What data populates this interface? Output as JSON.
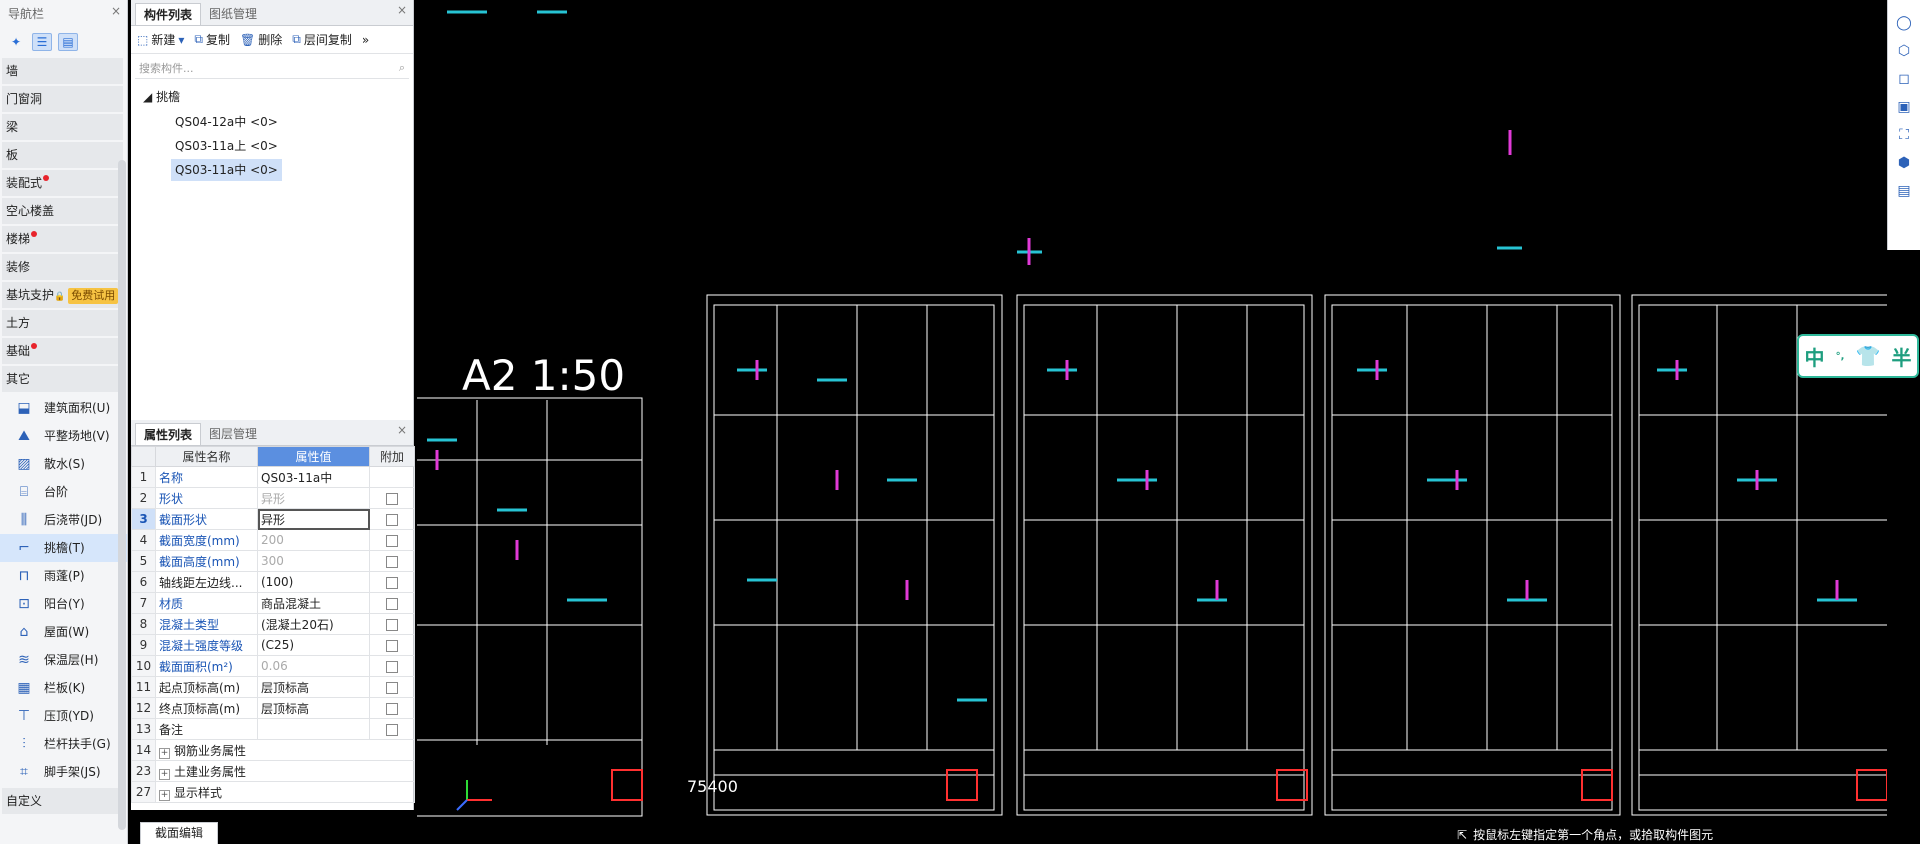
{
  "nav": {
    "title": "导航栏",
    "close": "×",
    "categories": [
      {
        "label": "墙"
      },
      {
        "label": "门窗洞"
      },
      {
        "label": "梁"
      },
      {
        "label": "板"
      },
      {
        "label": "装配式"
      },
      {
        "label": "空心楼盖"
      },
      {
        "label": "楼梯"
      },
      {
        "label": "装修"
      },
      {
        "label": "基坑支护",
        "badge": "免费试用"
      },
      {
        "label": "土方"
      },
      {
        "label": "基础"
      },
      {
        "label": "其它"
      }
    ],
    "subitems": [
      {
        "label": "建筑面积(U)",
        "icon": "area-icon"
      },
      {
        "label": "平整场地(V)",
        "icon": "level-site-icon"
      },
      {
        "label": "散水(S)",
        "icon": "apron-icon"
      },
      {
        "label": "台阶",
        "icon": "step-icon"
      },
      {
        "label": "后浇带(JD)",
        "icon": "post-pour-icon"
      },
      {
        "label": "挑檐(T)",
        "icon": "eave-icon"
      },
      {
        "label": "雨蓬(P)",
        "icon": "canopy-icon"
      },
      {
        "label": "阳台(Y)",
        "icon": "balcony-icon"
      },
      {
        "label": "屋面(W)",
        "icon": "roof-icon"
      },
      {
        "label": "保温层(H)",
        "icon": "insulation-icon"
      },
      {
        "label": "栏板(K)",
        "icon": "parapet-icon"
      },
      {
        "label": "压顶(YD)",
        "icon": "coping-icon"
      },
      {
        "label": "栏杆扶手(G)",
        "icon": "railing-icon"
      },
      {
        "label": "脚手架(JS)",
        "icon": "scaffold-icon"
      }
    ],
    "custom": "自定义"
  },
  "comp": {
    "tabs": [
      "构件列表",
      "图纸管理"
    ],
    "toolbar": {
      "new": "新建",
      "copy": "复制",
      "delete": "删除",
      "floor_copy": "层间复制"
    },
    "search_placeholder": "搜索构件...",
    "group": "挑檐",
    "items": [
      "QS04-12a中 <0>",
      "QS03-11a上 <0>",
      "QS03-11a中 <0>"
    ]
  },
  "prop": {
    "tabs": [
      "属性列表",
      "图层管理"
    ],
    "headers": [
      "属性名称",
      "属性值",
      "附加"
    ],
    "rows": [
      {
        "n": "1",
        "name": "名称",
        "val": "QS03-11a中",
        "chk": false
      },
      {
        "n": "2",
        "name": "形状",
        "val": "异形",
        "chk": true
      },
      {
        "n": "3",
        "name": "截面形状",
        "val": "异形",
        "chk": true
      },
      {
        "n": "4",
        "name": "截面宽度(mm)",
        "val": "200",
        "chk": true
      },
      {
        "n": "5",
        "name": "截面高度(mm)",
        "val": "300",
        "chk": true
      },
      {
        "n": "6",
        "name": "轴线距左边线...",
        "val": "(100)",
        "chk": true
      },
      {
        "n": "7",
        "name": "材质",
        "val": "商品混凝土",
        "chk": true
      },
      {
        "n": "8",
        "name": "混凝土类型",
        "val": "(混凝土20石)",
        "chk": true
      },
      {
        "n": "9",
        "name": "混凝土强度等级",
        "val": "(C25)",
        "chk": true
      },
      {
        "n": "10",
        "name": "截面面积(m²)",
        "val": "0.06",
        "chk": true
      },
      {
        "n": "11",
        "name": "起点顶标高(m)",
        "val": "层顶标高",
        "chk": true
      },
      {
        "n": "12",
        "name": "终点顶标高(m)",
        "val": "层顶标高",
        "chk": true
      },
      {
        "n": "13",
        "name": "备注",
        "val": "",
        "chk": true
      },
      {
        "n": "14",
        "name": "钢筋业务属性",
        "val": "",
        "chk": false
      },
      {
        "n": "23",
        "name": "土建业务属性",
        "val": "",
        "chk": false
      },
      {
        "n": "27",
        "name": "显示样式",
        "val": "",
        "chk": false
      }
    ]
  },
  "bottom_tab": "截面编辑",
  "canvas": {
    "sheet_label": "A2 1:50",
    "dim_text": "75400",
    "status": "按鼠标左键指定第一个角点，或拾取构件图元"
  },
  "ime": {
    "lang": "中",
    "punct": "°,",
    "shirt": "👕",
    "half": "半"
  }
}
